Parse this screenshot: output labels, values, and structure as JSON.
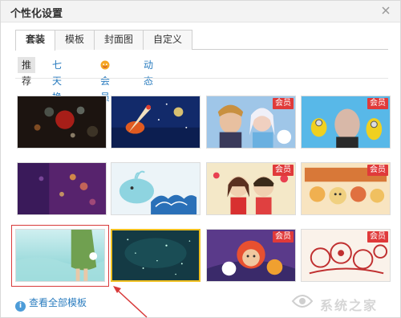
{
  "window": {
    "title": "个性化设置"
  },
  "tabs": [
    {
      "label": "套装",
      "active": true
    },
    {
      "label": "模板",
      "active": false
    },
    {
      "label": "封面图",
      "active": false
    },
    {
      "label": "自定义",
      "active": false
    }
  ],
  "subnav": [
    {
      "label": "推荐",
      "active": true
    },
    {
      "label": "七天换装",
      "active": false
    },
    {
      "label": "会员",
      "active": false,
      "icon": "vip-icon"
    },
    {
      "label": "动态",
      "active": false
    }
  ],
  "badge_label": "会员",
  "footer": {
    "view_all_label": "查看全部模板"
  },
  "watermark_text": "系统之家",
  "colors": {
    "accent": "#2a7cbf",
    "badge": "#e03a3a",
    "highlight": "#d83a3a",
    "selected": "#f0c020"
  }
}
